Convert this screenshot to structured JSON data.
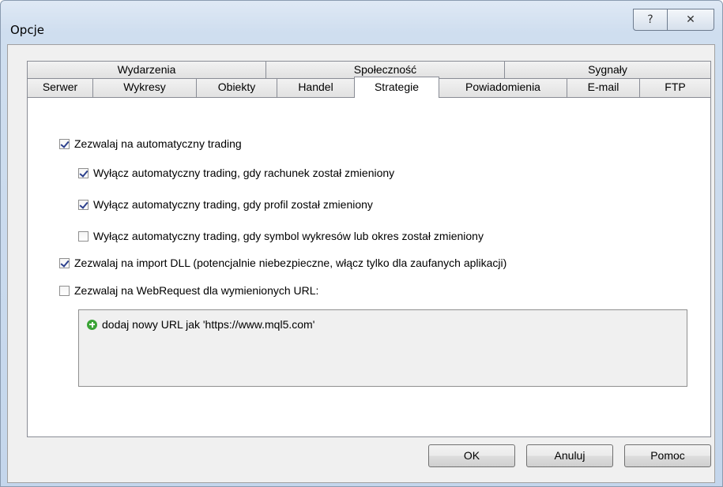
{
  "window": {
    "title": "Opcje"
  },
  "titlebar": {
    "help_glyph": "?",
    "close_glyph": "✕"
  },
  "tabs": {
    "row1": [
      "Wydarzenia",
      "Społeczność",
      "Sygnały"
    ],
    "row2": [
      "Serwer",
      "Wykresy",
      "Obiekty",
      "Handel",
      "Strategie",
      "Powiadomienia",
      "E-mail",
      "FTP"
    ],
    "active": "Strategie"
  },
  "options": [
    {
      "label": "Zezwalaj na automatyczny trading",
      "checked": true
    },
    {
      "label": "Wyłącz automatyczny trading, gdy rachunek został zmieniony",
      "checked": true
    },
    {
      "label": "Wyłącz automatyczny trading, gdy profil został zmieniony",
      "checked": true
    },
    {
      "label": "Wyłącz automatyczny trading, gdy symbol wykresów lub okres został zmieniony",
      "checked": false
    },
    {
      "label": "Zezwalaj na import DLL (potencjalnie niebezpieczne, włącz tylko dla zaufanych aplikacji)",
      "checked": true
    },
    {
      "label": "Zezwalaj na WebRequest dla wymienionych URL:",
      "checked": false
    }
  ],
  "url_list": {
    "add_label": "dodaj nowy URL jak 'https://www.mql5.com'"
  },
  "buttons": {
    "ok": "OK",
    "cancel": "Anuluj",
    "help": "Pomoc"
  }
}
